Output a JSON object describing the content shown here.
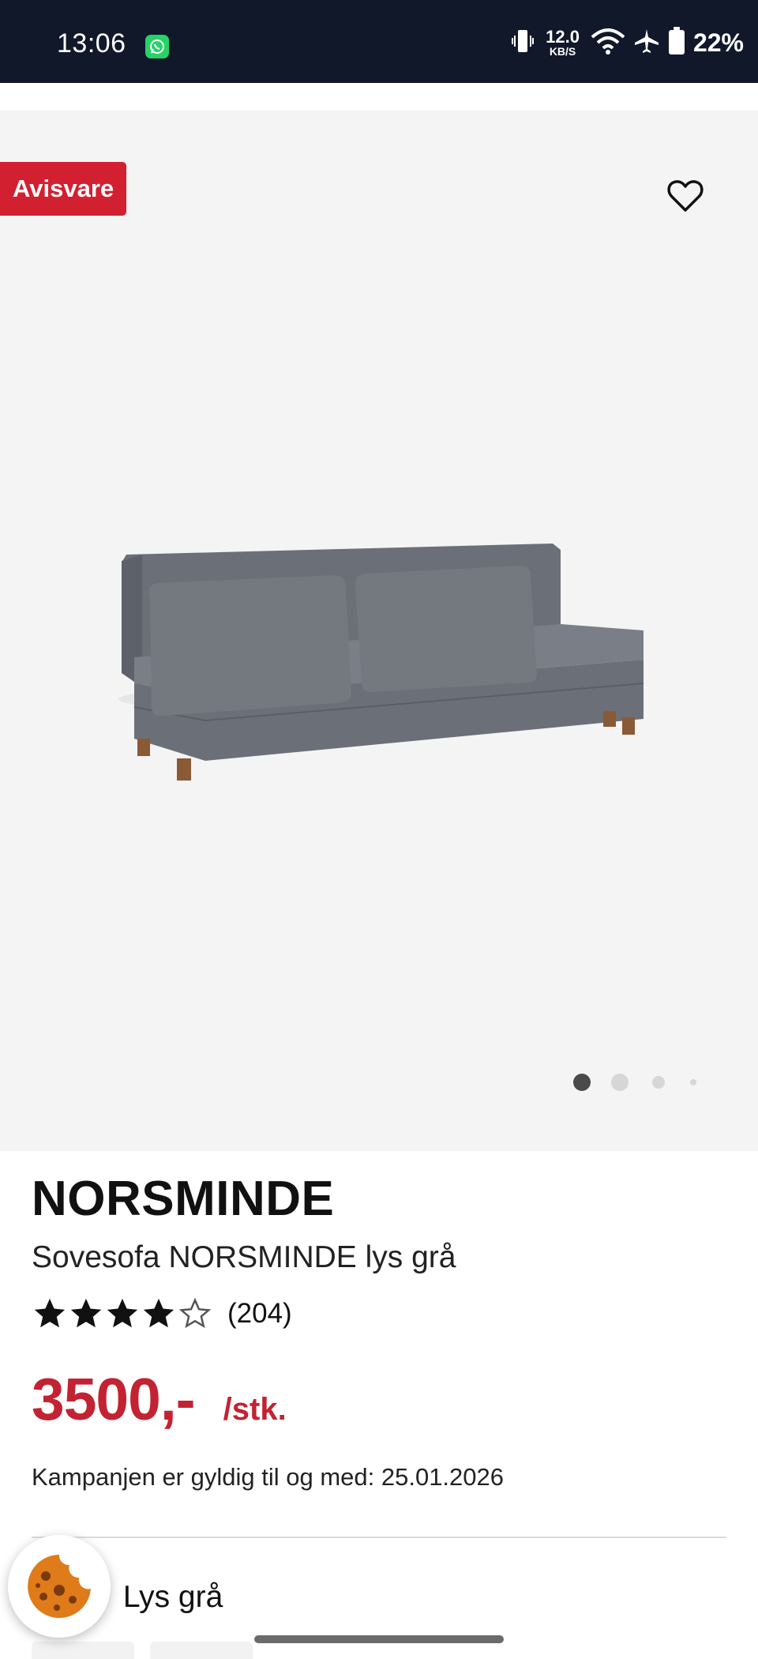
{
  "status_bar": {
    "time": "13:06",
    "net_speed_value": "12.0",
    "net_speed_unit": "KB/S",
    "battery": "22%",
    "icons": [
      "whatsapp-icon",
      "vibrate-icon",
      "wifi-icon",
      "airplane-icon",
      "battery-icon"
    ]
  },
  "gallery": {
    "badge": "Avisvare",
    "favorite_icon": "heart-icon",
    "image_count": 4,
    "active_index": 0
  },
  "product": {
    "brand": "NORSMINDE",
    "subtitle": "Sovesofa NORSMINDE lys grå",
    "rating": 4,
    "rating_max": 5,
    "review_count": "(204)",
    "price": "3500,-",
    "unit": "/stk.",
    "campaign": "Kampanjen er gyldig til og med: 25.01.2026",
    "color_label_visible": ":",
    "color_value": "Lys grå"
  },
  "colors": {
    "badge_red": "#d32030",
    "price_red": "#c22333",
    "status_bar_bg": "#11182a",
    "gallery_bg": "#f4f4f4"
  }
}
